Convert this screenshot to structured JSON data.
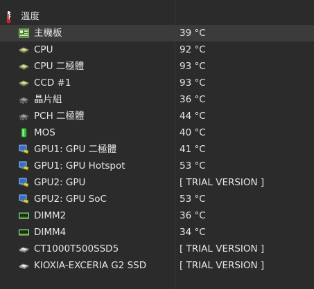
{
  "section": {
    "title": "溫度",
    "icon": "thermometer-icon"
  },
  "colors": {
    "background": "#2b2b2b",
    "text": "#e6e6e6",
    "grid": "#3c3c3c",
    "selected_row": "#3b3b3b"
  },
  "rows": [
    {
      "label": "主機板",
      "value": "39 °C",
      "icon": "motherboard-icon"
    },
    {
      "label": "CPU",
      "value": "92 °C",
      "icon": "cpu-chip-icon"
    },
    {
      "label": "CPU 二極體",
      "value": "93 °C",
      "icon": "cpu-chip-icon"
    },
    {
      "label": "CCD #1",
      "value": "93 °C",
      "icon": "cpu-chip-icon"
    },
    {
      "label": "晶片組",
      "value": "36 °C",
      "icon": "chipset-icon"
    },
    {
      "label": "PCH 二極體",
      "value": "44 °C",
      "icon": "chipset-icon"
    },
    {
      "label": "MOS",
      "value": "40 °C",
      "icon": "mos-battery-icon"
    },
    {
      "label": "GPU1: GPU 二極體",
      "value": "41 °C",
      "icon": "gpu-monitor-icon"
    },
    {
      "label": "GPU1: GPU Hotspot",
      "value": "53 °C",
      "icon": "gpu-monitor-icon"
    },
    {
      "label": "GPU2: GPU",
      "value": "[ TRIAL VERSION ]",
      "icon": "gpu-monitor-icon"
    },
    {
      "label": "GPU2: GPU SoC",
      "value": "53 °C",
      "icon": "gpu-monitor-icon"
    },
    {
      "label": "DIMM2",
      "value": "36 °C",
      "icon": "ram-module-icon"
    },
    {
      "label": "DIMM4",
      "value": "34 °C",
      "icon": "ram-module-icon"
    },
    {
      "label": "CT1000T500SSD5",
      "value": "[ TRIAL VERSION ]",
      "icon": "ssd-drive-icon"
    },
    {
      "label": "KIOXIA-EXCERIA G2 SSD",
      "value": "[ TRIAL VERSION ]",
      "icon": "ssd-drive-icon"
    }
  ]
}
